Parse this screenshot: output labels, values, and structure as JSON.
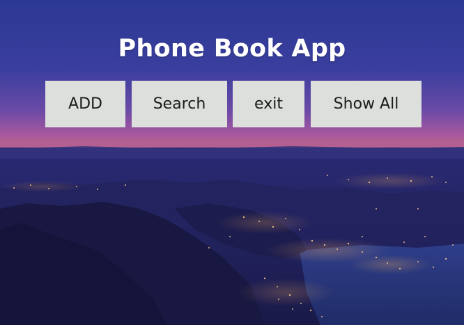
{
  "app": {
    "title": "Phone Book App"
  },
  "buttons": {
    "add": "ADD",
    "search": "Search",
    "exit": "exit",
    "show_all": "Show All"
  },
  "colors": {
    "button_bg": "#dcdfdb",
    "title_text": "#ffffff",
    "sky_top": "#27368f",
    "sky_horizon": "#b85a9e"
  }
}
